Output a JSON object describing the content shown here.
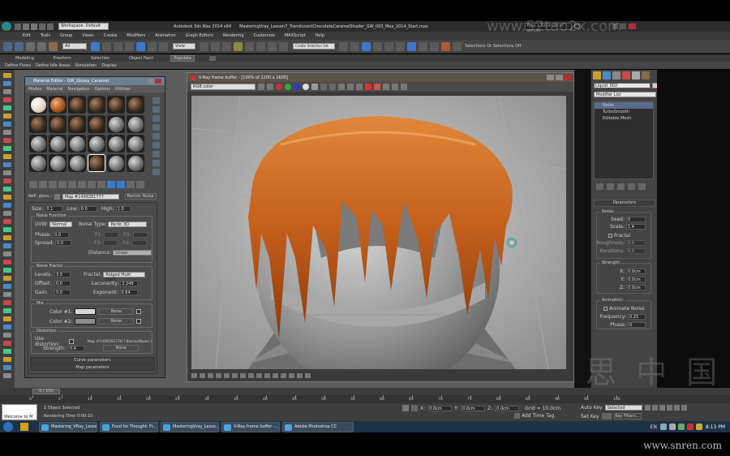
{
  "app": {
    "title": "Autodesk 3ds Max 2014 x64",
    "file": "MasteringVray_Lesson7_TranslucentChocolateCaramelShader_GW_003_Max_2014_Start.max",
    "workspace": "Workspace: Default",
    "search_placeholder": "Type a keyword or phrase"
  },
  "menu": [
    "Edit",
    "Tools",
    "Group",
    "Views",
    "Create",
    "Modifiers",
    "Animation",
    "Graph Editors",
    "Rendering",
    "Customize",
    "MAXScript",
    "Help"
  ],
  "toolbar": {
    "selection_filter": "All",
    "ref_coord": "View",
    "named_selection": "Create Selection Set",
    "selection_help": "Selections Or Selections Off"
  },
  "ribbon_tabs": [
    "Modeling",
    "Freeform",
    "Selection",
    "Object Paint",
    "Populate"
  ],
  "ribbon_sub": [
    "Define Flows",
    "Define Idle Areas",
    "Simulation",
    "Display"
  ],
  "material_editor": {
    "title": "Material Editor - GW_Glossy_Caramel",
    "menu": [
      "Modes",
      "Material",
      "Navigation",
      "Options",
      "Utilities"
    ],
    "map_slot_label": "Refl. gloss.:",
    "map_name": "Map #1499281777",
    "map_type": "Bercon Noise",
    "noise_size": "0.1",
    "noise_low": "0.0",
    "noise_high": "1.0",
    "noise_function_title": "Noise Function",
    "uvw_label": "UVW:",
    "uvw": "Normal",
    "noise_type_label": "Noise Type:",
    "noise_type": "Perlin 3D",
    "phase_label": "Phase:",
    "phase": "0.0",
    "spread_label": "Spread:",
    "spread": "0.0",
    "f1": "F1:",
    "f2": "F2:",
    "f3": "F3:",
    "f4": "F4:",
    "distance_label": "Distance:",
    "distance": "Linear",
    "noise_fractal_title": "Noise Fractal",
    "levels_label": "Levels:",
    "levels": "3.0",
    "fractal_label": "Fractal:",
    "fractal": "Ridged Multi Fract.",
    "offset_label": "Offset:",
    "offset": "0.0",
    "lacunarity_label": "Lacunarity:",
    "lacunarity": "2.248",
    "gain_label": "Gain:",
    "gain": "5.0",
    "exponent_label": "Exponent:",
    "exponent": "0.64",
    "mix_title": "Mix",
    "color1_label": "Color #1:",
    "color2_label": "Color #2:",
    "none": "None",
    "distortion_title": "Distortion",
    "use_distortion": "Use distortion:",
    "distortion_map": "Map #1499281776  ( BerconNoise )",
    "strength_label": "Strength:",
    "strength": "0.4",
    "rollouts": [
      "Curve parameters",
      "Map parameters"
    ]
  },
  "frame_buffer": {
    "title": "V-Ray frame buffer - [100% of 1200 x 1600]",
    "channel": "RGB color"
  },
  "command_panel": {
    "object_name": "Liquid_002",
    "modifier_list": "Modifier List",
    "stack": [
      "Noise",
      "TurboSmooth",
      "Editable Mesh"
    ],
    "params_title": "Parameters",
    "noise_group": "Noise:",
    "seed_label": "Seed:",
    "seed": "0",
    "scale_label": "Scale:",
    "scale": "1.4",
    "fractal_cb": "Fractal",
    "roughness_label": "Roughness:",
    "roughness": "0.0",
    "iterations_label": "Iterations:",
    "iterations": "6.0",
    "strength_group": "Strength:",
    "x_label": "X:",
    "x": "0.0cm",
    "y_label": "Y:",
    "y": "0.0cm",
    "z_label": "Z:",
    "z": "0.0cm",
    "animation_group": "Animation:",
    "animate_noise": "Animate Noise",
    "frequency_label": "Frequency:",
    "frequency": "0.25",
    "phase_label": "Phase:",
    "phase": "0"
  },
  "timeline": {
    "frame": "0 / 100",
    "ticks": [
      "0",
      "5",
      "10",
      "15",
      "20",
      "25",
      "30",
      "35",
      "40",
      "45",
      "50",
      "55",
      "60",
      "65",
      "70",
      "75",
      "80",
      "85",
      "90",
      "95",
      "100"
    ]
  },
  "status": {
    "selected": "1 Object Selected",
    "render_time": "Rendering Time 0:00:10",
    "listener": "Welcome to M",
    "x": "0.0cm",
    "y": "0.0cm",
    "z": "0.0cm",
    "grid": "Grid = 10.0cm",
    "add_time_tag": "Add Time Tag",
    "auto_key": "Auto Key",
    "set_key": "Set Key",
    "selected_dd": "Selected",
    "key_filters": "Key Filters..."
  },
  "taskbar": {
    "tasks": [
      "Mastering_VRay_Lesso...",
      "Food for Thought: Fr...",
      "MasteringVray_Lesso...",
      "V-Ray frame buffer -...",
      "Adobe Photoshop CC"
    ],
    "lang": "EN",
    "time": "8:13 PM"
  },
  "watermarks": {
    "top": "www.52tao2x.com",
    "bottom": "www.snren.com",
    "cn": "思 中 国"
  },
  "colors": {
    "ui_bg": "#444444",
    "caramel": "#c8641e",
    "accent": "#4aa3df"
  }
}
